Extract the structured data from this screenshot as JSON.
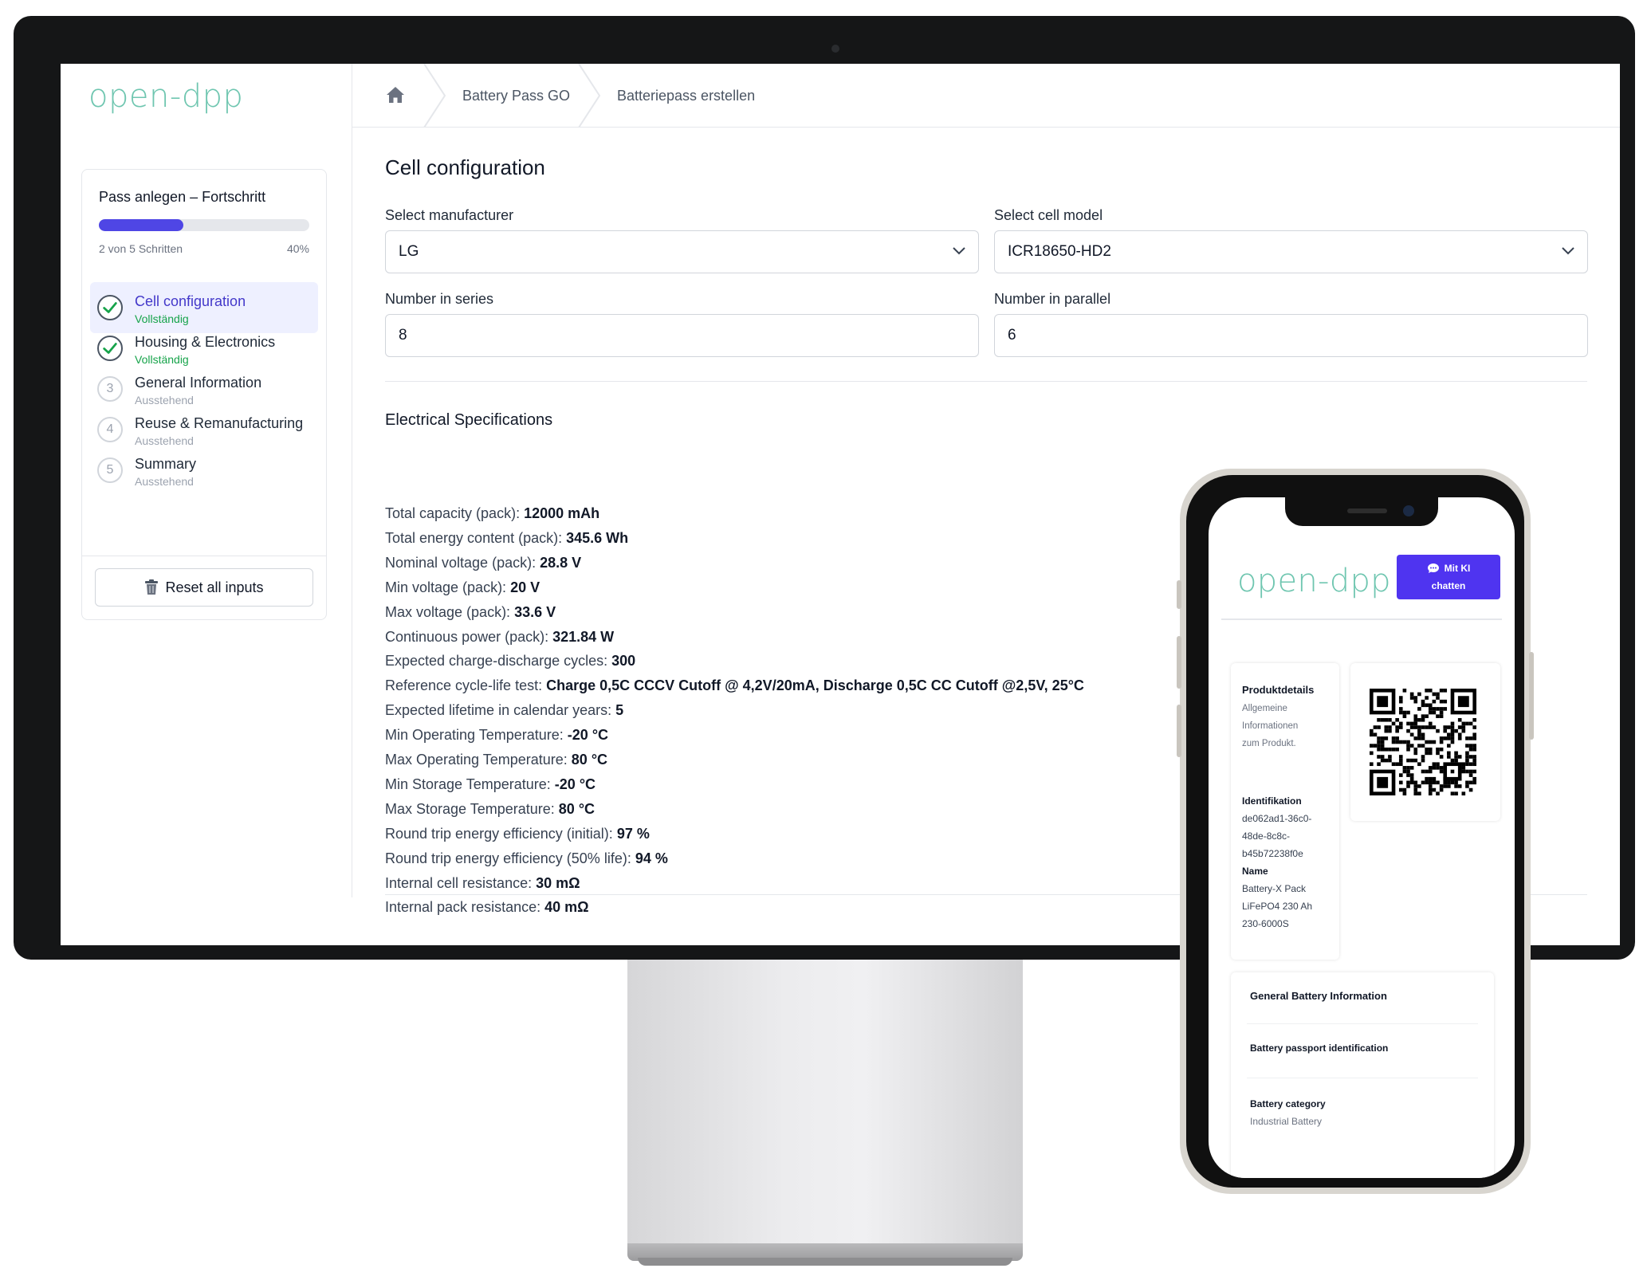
{
  "sidebar": {
    "logo": "open-dpp",
    "progress": {
      "title": "Pass anlegen – Fortschritt",
      "steps_text": "2 von 5 Schritten",
      "percent_text": "40%",
      "fraction": 0.4
    },
    "steps": [
      {
        "label": "Cell configuration",
        "status": "Vollständig",
        "number": "",
        "state": "done",
        "active": true
      },
      {
        "label": "Housing & Electronics",
        "status": "Vollständig",
        "number": "",
        "state": "done",
        "active": false
      },
      {
        "label": "General Information",
        "status": "Ausstehend",
        "number": "3",
        "state": "pending",
        "active": false
      },
      {
        "label": "Reuse & Remanufacturing",
        "status": "Ausstehend",
        "number": "4",
        "state": "pending",
        "active": false
      },
      {
        "label": "Summary",
        "status": "Ausstehend",
        "number": "5",
        "state": "pending",
        "active": false
      }
    ],
    "reset_label": "Reset all inputs"
  },
  "breadcrumb": {
    "items": [
      "Battery Pass GO",
      "Batteriepass erstellen"
    ]
  },
  "form": {
    "title": "Cell configuration",
    "manufacturer_label": "Select manufacturer",
    "manufacturer_value": "LG",
    "cell_model_label": "Select cell model",
    "cell_model_value": "ICR18650-HD2",
    "series_label": "Number in series",
    "series_value": "8",
    "parallel_label": "Number in parallel",
    "parallel_value": "6"
  },
  "specs": {
    "title": "Electrical Specifications",
    "items": [
      {
        "label": "Total capacity (pack):",
        "value": "12000 mAh"
      },
      {
        "label": "Total energy content (pack):",
        "value": "345.6 Wh"
      },
      {
        "label": "Nominal voltage (pack):",
        "value": "28.8 V"
      },
      {
        "label": "Min voltage (pack):",
        "value": "20 V"
      },
      {
        "label": "Max voltage (pack):",
        "value": "33.6 V"
      },
      {
        "label": "Continuous power (pack):",
        "value": "321.84 W"
      },
      {
        "label": "Expected charge-discharge cycles:",
        "value": "300"
      },
      {
        "label": "Reference cycle-life test:",
        "value": "Charge 0,5C CCCV Cutoff @ 4,2V/20mA, Discharge 0,5C CC Cutoff @2,5V, 25°C"
      },
      {
        "label": "Expected lifetime in calendar years:",
        "value": "5"
      },
      {
        "label": "Min Operating Temperature:",
        "value": "-20 °C"
      },
      {
        "label": "Max Operating Temperature:",
        "value": "80 °C"
      },
      {
        "label": "Min Storage Temperature:",
        "value": "-20 °C"
      },
      {
        "label": "Max Storage Temperature:",
        "value": "80 °C"
      },
      {
        "label": "Round trip energy efficiency (initial):",
        "value": "97 %"
      },
      {
        "label": "Round trip energy efficiency (50% life):",
        "value": "94 %"
      },
      {
        "label": "Internal cell resistance:",
        "value": "30 mΩ"
      },
      {
        "label": "Internal pack resistance:",
        "value": "40 mΩ"
      }
    ]
  },
  "mobile": {
    "logo": "open-dpp",
    "chat_line1": "Mit KI",
    "chat_line2": "chatten",
    "details_title": "Produktdetails",
    "details_sub": [
      "Allgemeine",
      "Informationen",
      "zum Produkt."
    ],
    "id_label": "Identifikation",
    "id_value": [
      "de062ad1-36c0-",
      "48de-8c8c-",
      "b45b72238f0e"
    ],
    "name_label": "Name",
    "name_value": [
      "Battery-X Pack",
      "LiFePO4 230 Ah",
      "230-6000S"
    ],
    "general_title": "General Battery Information",
    "passport_id_label": "Battery passport identification",
    "category_label": "Battery category",
    "category_value": "Industrial Battery"
  },
  "colors": {
    "accent": "#4f46e5",
    "logo": "#6fc6b0",
    "success": "#16a34a",
    "chat_button": "#4f34f0"
  }
}
